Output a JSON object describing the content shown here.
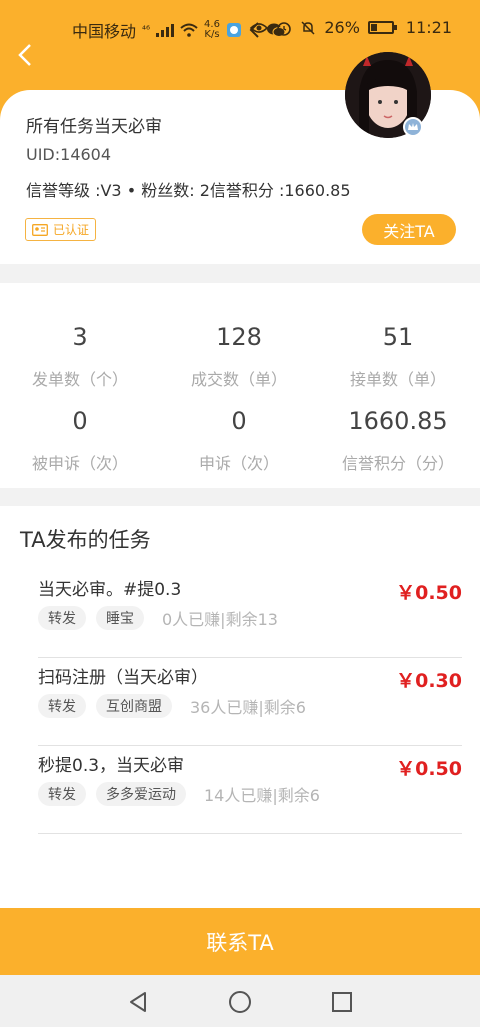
{
  "status_bar": {
    "carrier": "中国移动",
    "net_type": "⁴⁶",
    "speed_top": "4.6",
    "speed_bottom": "K/s",
    "battery": "26%",
    "time": "11:21"
  },
  "profile": {
    "name": "所有任务当天必审",
    "uid": "UID:14604",
    "credit_line": "信誉等级 :V3 • 粉丝数: 2信誉积分 :1660.85",
    "verified_label": "已认证",
    "follow_label": "关注TA"
  },
  "stats": [
    {
      "value": "3",
      "label": "发单数（个）"
    },
    {
      "value": "128",
      "label": "成交数（单）"
    },
    {
      "value": "51",
      "label": "接单数（单）"
    },
    {
      "value": "0",
      "label": "被申诉（次）"
    },
    {
      "value": "0",
      "label": "申诉（次）"
    },
    {
      "value": "1660.85",
      "label": "信誉积分（分）"
    }
  ],
  "tasks_section": {
    "title": "TA发布的任务",
    "items": [
      {
        "title": "当天必审。#提0.3",
        "price": "￥0.50",
        "tags": [
          "转发",
          "睡宝"
        ],
        "stat": "0人已赚|剩余13"
      },
      {
        "title": "扫码注册（当天必审）",
        "price": "￥0.30",
        "tags": [
          "转发",
          "互创商盟"
        ],
        "stat": "36人已赚|剩余6"
      },
      {
        "title": "秒提0.3，当天必审",
        "price": "￥0.50",
        "tags": [
          "转发",
          "多多爱运动"
        ],
        "stat": "14人已赚|剩余6"
      }
    ]
  },
  "contact_label": "联系TA",
  "colors": {
    "accent": "#fbb02c",
    "price": "#e02020"
  }
}
